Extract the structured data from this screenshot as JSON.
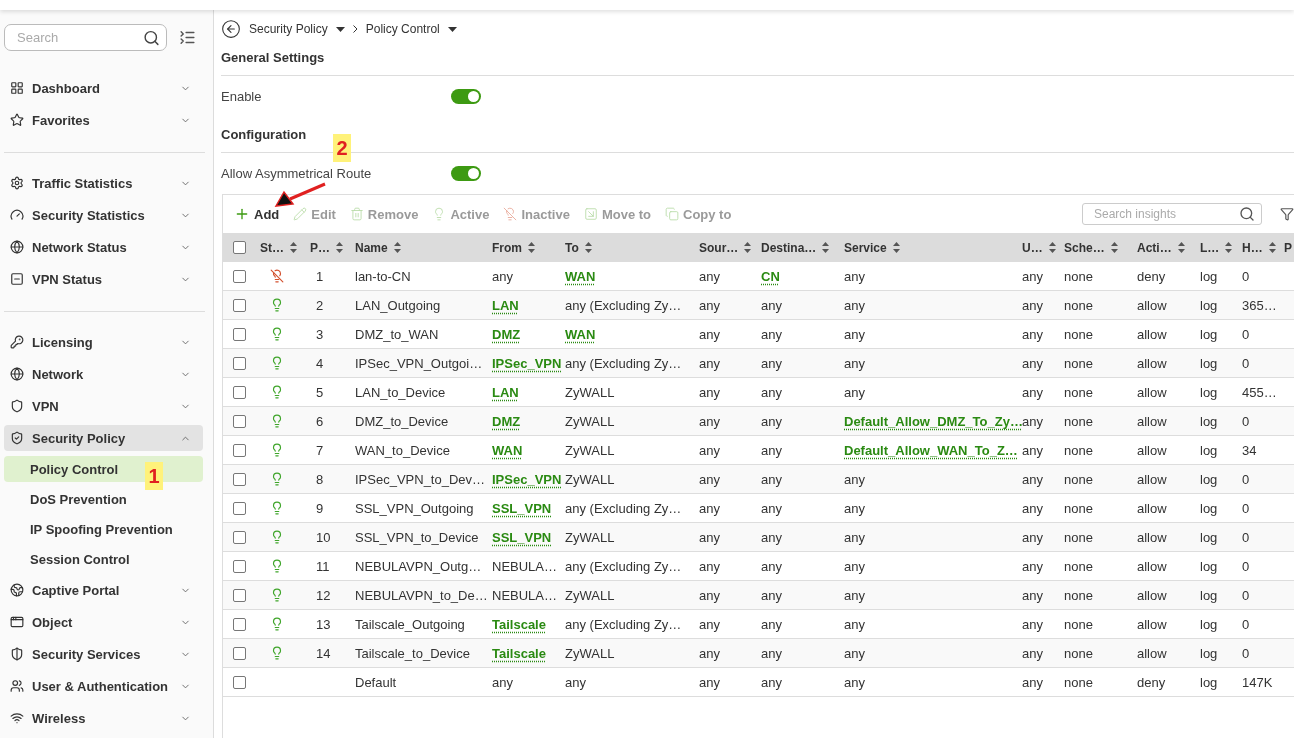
{
  "sidebar": {
    "search": {
      "placeholder": "Search"
    },
    "groups": [
      {
        "items": [
          {
            "label": "Dashboard",
            "kind": "item",
            "expanded": false
          },
          {
            "label": "Favorites",
            "kind": "item",
            "expanded": false
          }
        ]
      },
      {
        "items": [
          {
            "label": "Traffic Statistics",
            "kind": "item",
            "expanded": false
          },
          {
            "label": "Security Statistics",
            "kind": "item",
            "expanded": false
          },
          {
            "label": "Network Status",
            "kind": "item",
            "expanded": false
          },
          {
            "label": "VPN Status",
            "kind": "item",
            "expanded": false
          }
        ]
      },
      {
        "items": [
          {
            "label": "Licensing",
            "kind": "item",
            "expanded": false
          },
          {
            "label": "Network",
            "kind": "item",
            "expanded": false
          },
          {
            "label": "VPN",
            "kind": "item",
            "expanded": false
          },
          {
            "label": "Security Policy",
            "kind": "item",
            "expanded": true
          },
          {
            "label": "Policy Control",
            "kind": "sub",
            "selected": true
          },
          {
            "label": "DoS Prevention",
            "kind": "sub",
            "selected": false
          },
          {
            "label": "IP Spoofing Prevention",
            "kind": "sub",
            "selected": false
          },
          {
            "label": "Session Control",
            "kind": "sub",
            "selected": false
          },
          {
            "label": "Captive Portal",
            "kind": "item",
            "expanded": false
          },
          {
            "label": "Object",
            "kind": "item",
            "expanded": false
          },
          {
            "label": "Security Services",
            "kind": "item",
            "expanded": false
          },
          {
            "label": "User & Authentication",
            "kind": "item",
            "expanded": false
          },
          {
            "label": "Wireless",
            "kind": "item",
            "expanded": false
          }
        ]
      }
    ]
  },
  "breadcrumb": [
    {
      "label": "Security Policy"
    },
    {
      "label": "Policy Control"
    }
  ],
  "sections": [
    {
      "title": "General Settings",
      "settings": [
        {
          "label": "Enable",
          "on": true
        }
      ]
    },
    {
      "title": "Configuration",
      "settings": [
        {
          "label": "Allow Asymmetrical Route",
          "on": true
        }
      ]
    }
  ],
  "toolbar": {
    "buttons": [
      {
        "label": "Add",
        "kind": "add",
        "disabled": false
      },
      {
        "label": "Edit",
        "kind": "edit",
        "disabled": true
      },
      {
        "label": "Remove",
        "kind": "remove",
        "disabled": true
      },
      {
        "label": "Active",
        "kind": "active",
        "disabled": true
      },
      {
        "label": "Inactive",
        "kind": "inactive",
        "disabled": true
      },
      {
        "label": "Move to",
        "kind": "move",
        "disabled": true
      },
      {
        "label": "Copy to",
        "kind": "copy",
        "disabled": true
      }
    ],
    "search": {
      "placeholder": "Search insights"
    }
  },
  "table": {
    "header_checked": false,
    "columns": [
      {
        "label": "St…",
        "sortable": true
      },
      {
        "label": "P…",
        "sortable": true
      },
      {
        "label": "Name",
        "sortable": true
      },
      {
        "label": "From",
        "sortable": true
      },
      {
        "label": "To",
        "sortable": true
      },
      {
        "label": "Sour…",
        "sortable": true
      },
      {
        "label": "Destina…",
        "sortable": true
      },
      {
        "label": "Service",
        "sortable": true
      },
      {
        "label": "U…",
        "sortable": true
      },
      {
        "label": "Sche…",
        "sortable": true
      },
      {
        "label": "Acti…",
        "sortable": true
      },
      {
        "label": "L…",
        "sortable": true
      },
      {
        "label": "H…",
        "sortable": true
      },
      {
        "label": "P"
      }
    ],
    "rows": [
      {
        "checked": false,
        "cells": [
          {
            "kind": "status",
            "active": false
          },
          {
            "text": "1"
          },
          {
            "text": "lan-to-CN"
          },
          {
            "text": "any"
          },
          {
            "text": "WAN",
            "kind": "link"
          },
          {
            "text": "any"
          },
          {
            "text": "CN",
            "kind": "link"
          },
          {
            "text": "any"
          },
          {
            "text": "any"
          },
          {
            "text": "none"
          },
          {
            "text": "deny"
          },
          {
            "text": "log"
          },
          {
            "text": "0"
          }
        ]
      },
      {
        "checked": false,
        "cells": [
          {
            "kind": "status",
            "active": true
          },
          {
            "text": "2"
          },
          {
            "text": "LAN_Outgoing"
          },
          {
            "text": "LAN",
            "kind": "link"
          },
          {
            "text": "any (Excluding Zy…"
          },
          {
            "text": "any"
          },
          {
            "text": "any"
          },
          {
            "text": "any"
          },
          {
            "text": "any"
          },
          {
            "text": "none"
          },
          {
            "text": "allow"
          },
          {
            "text": "log"
          },
          {
            "text": "365…"
          }
        ]
      },
      {
        "checked": false,
        "cells": [
          {
            "kind": "status",
            "active": true
          },
          {
            "text": "3"
          },
          {
            "text": "DMZ_to_WAN"
          },
          {
            "text": "DMZ",
            "kind": "link"
          },
          {
            "text": "WAN",
            "kind": "link"
          },
          {
            "text": "any"
          },
          {
            "text": "any"
          },
          {
            "text": "any"
          },
          {
            "text": "any"
          },
          {
            "text": "none"
          },
          {
            "text": "allow"
          },
          {
            "text": "log"
          },
          {
            "text": "0"
          }
        ]
      },
      {
        "checked": false,
        "cells": [
          {
            "kind": "status",
            "active": true
          },
          {
            "text": "4"
          },
          {
            "text": "IPSec_VPN_Outgoi…"
          },
          {
            "text": "IPSec_VPN",
            "kind": "link"
          },
          {
            "text": "any (Excluding Zy…"
          },
          {
            "text": "any"
          },
          {
            "text": "any"
          },
          {
            "text": "any"
          },
          {
            "text": "any"
          },
          {
            "text": "none"
          },
          {
            "text": "allow"
          },
          {
            "text": "log"
          },
          {
            "text": "0"
          }
        ]
      },
      {
        "checked": false,
        "cells": [
          {
            "kind": "status",
            "active": true
          },
          {
            "text": "5"
          },
          {
            "text": "LAN_to_Device"
          },
          {
            "text": "LAN",
            "kind": "link"
          },
          {
            "text": "ZyWALL"
          },
          {
            "text": "any"
          },
          {
            "text": "any"
          },
          {
            "text": "any"
          },
          {
            "text": "any"
          },
          {
            "text": "none"
          },
          {
            "text": "allow"
          },
          {
            "text": "log"
          },
          {
            "text": "455…"
          }
        ]
      },
      {
        "checked": false,
        "cells": [
          {
            "kind": "status",
            "active": true
          },
          {
            "text": "6"
          },
          {
            "text": "DMZ_to_Device"
          },
          {
            "text": "DMZ",
            "kind": "link"
          },
          {
            "text": "ZyWALL"
          },
          {
            "text": "any"
          },
          {
            "text": "any"
          },
          {
            "text": "Default_Allow_DMZ_To_Zy…",
            "kind": "link"
          },
          {
            "text": "any"
          },
          {
            "text": "none"
          },
          {
            "text": "allow"
          },
          {
            "text": "log"
          },
          {
            "text": "0"
          }
        ]
      },
      {
        "checked": false,
        "cells": [
          {
            "kind": "status",
            "active": true
          },
          {
            "text": "7"
          },
          {
            "text": "WAN_to_Device"
          },
          {
            "text": "WAN",
            "kind": "link"
          },
          {
            "text": "ZyWALL"
          },
          {
            "text": "any"
          },
          {
            "text": "any"
          },
          {
            "text": "Default_Allow_WAN_To_Z…",
            "kind": "link"
          },
          {
            "text": "any"
          },
          {
            "text": "none"
          },
          {
            "text": "allow"
          },
          {
            "text": "log"
          },
          {
            "text": "34"
          }
        ]
      },
      {
        "checked": false,
        "cells": [
          {
            "kind": "status",
            "active": true
          },
          {
            "text": "8"
          },
          {
            "text": "IPSec_VPN_to_Dev…"
          },
          {
            "text": "IPSec_VPN",
            "kind": "link"
          },
          {
            "text": "ZyWALL"
          },
          {
            "text": "any"
          },
          {
            "text": "any"
          },
          {
            "text": "any"
          },
          {
            "text": "any"
          },
          {
            "text": "none"
          },
          {
            "text": "allow"
          },
          {
            "text": "log"
          },
          {
            "text": "0"
          }
        ]
      },
      {
        "checked": false,
        "cells": [
          {
            "kind": "status",
            "active": true
          },
          {
            "text": "9"
          },
          {
            "text": "SSL_VPN_Outgoing"
          },
          {
            "text": "SSL_VPN",
            "kind": "link"
          },
          {
            "text": "any (Excluding Zy…"
          },
          {
            "text": "any"
          },
          {
            "text": "any"
          },
          {
            "text": "any"
          },
          {
            "text": "any"
          },
          {
            "text": "none"
          },
          {
            "text": "allow"
          },
          {
            "text": "log"
          },
          {
            "text": "0"
          }
        ]
      },
      {
        "checked": false,
        "cells": [
          {
            "kind": "status",
            "active": true
          },
          {
            "text": "10"
          },
          {
            "text": "SSL_VPN_to_Device"
          },
          {
            "text": "SSL_VPN",
            "kind": "link"
          },
          {
            "text": "ZyWALL"
          },
          {
            "text": "any"
          },
          {
            "text": "any"
          },
          {
            "text": "any"
          },
          {
            "text": "any"
          },
          {
            "text": "none"
          },
          {
            "text": "allow"
          },
          {
            "text": "log"
          },
          {
            "text": "0"
          }
        ]
      },
      {
        "checked": false,
        "cells": [
          {
            "kind": "status",
            "active": true
          },
          {
            "text": "11"
          },
          {
            "text": "NEBULAVPN_Outg…"
          },
          {
            "text": "NEBULA…"
          },
          {
            "text": "any (Excluding Zy…"
          },
          {
            "text": "any"
          },
          {
            "text": "any"
          },
          {
            "text": "any"
          },
          {
            "text": "any"
          },
          {
            "text": "none"
          },
          {
            "text": "allow"
          },
          {
            "text": "log"
          },
          {
            "text": "0"
          }
        ]
      },
      {
        "checked": false,
        "cells": [
          {
            "kind": "status",
            "active": true
          },
          {
            "text": "12"
          },
          {
            "text": "NEBULAVPN_to_De…"
          },
          {
            "text": "NEBULA…"
          },
          {
            "text": "ZyWALL"
          },
          {
            "text": "any"
          },
          {
            "text": "any"
          },
          {
            "text": "any"
          },
          {
            "text": "any"
          },
          {
            "text": "none"
          },
          {
            "text": "allow"
          },
          {
            "text": "log"
          },
          {
            "text": "0"
          }
        ]
      },
      {
        "checked": false,
        "cells": [
          {
            "kind": "status",
            "active": true
          },
          {
            "text": "13"
          },
          {
            "text": "Tailscale_Outgoing"
          },
          {
            "text": "Tailscale",
            "kind": "link"
          },
          {
            "text": "any (Excluding Zy…"
          },
          {
            "text": "any"
          },
          {
            "text": "any"
          },
          {
            "text": "any"
          },
          {
            "text": "any"
          },
          {
            "text": "none"
          },
          {
            "text": "allow"
          },
          {
            "text": "log"
          },
          {
            "text": "0"
          }
        ]
      },
      {
        "checked": false,
        "cells": [
          {
            "kind": "status",
            "active": true
          },
          {
            "text": "14"
          },
          {
            "text": "Tailscale_to_Device"
          },
          {
            "text": "Tailscale",
            "kind": "link"
          },
          {
            "text": "ZyWALL"
          },
          {
            "text": "any"
          },
          {
            "text": "any"
          },
          {
            "text": "any"
          },
          {
            "text": "any"
          },
          {
            "text": "none"
          },
          {
            "text": "allow"
          },
          {
            "text": "log"
          },
          {
            "text": "0"
          }
        ]
      },
      {
        "checked": false,
        "cells": [
          {
            "text": ""
          },
          {
            "text": ""
          },
          {
            "text": "Default"
          },
          {
            "text": "any"
          },
          {
            "text": "any"
          },
          {
            "text": "any"
          },
          {
            "text": "any"
          },
          {
            "text": "any"
          },
          {
            "text": "any"
          },
          {
            "text": "none"
          },
          {
            "text": "deny"
          },
          {
            "text": "log"
          },
          {
            "text": "147K"
          }
        ]
      }
    ]
  },
  "annotations": [
    {
      "label": "1"
    },
    {
      "label": "2"
    }
  ]
}
